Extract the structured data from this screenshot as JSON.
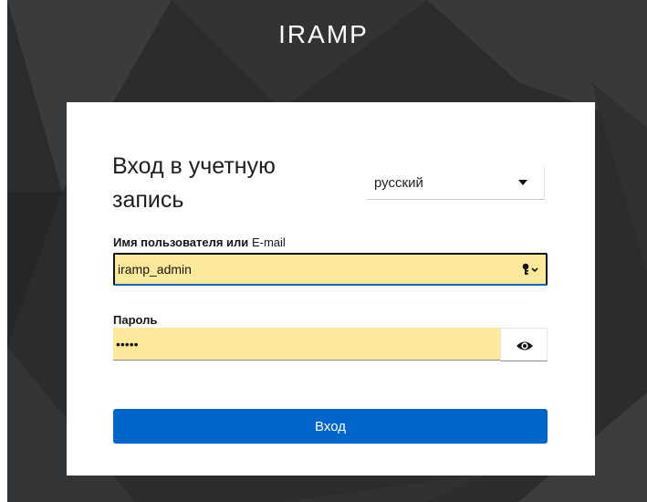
{
  "brand": {
    "title": "IRAMP"
  },
  "login": {
    "heading": "Вход в учетную запись",
    "language": {
      "selected": "русский",
      "icon": "caret-down-icon"
    },
    "username": {
      "label_bold": "Имя пользователя или",
      "label_light": "E-mail",
      "value": "iramp_admin",
      "icon": "key-icon"
    },
    "password": {
      "label": "Пароль",
      "value": "•••••",
      "toggle_icon": "eye-icon"
    },
    "submit_label": "Вход"
  },
  "colors": {
    "backdrop": "#2b2c2e",
    "autofill": "#fde99a",
    "primary": "#0066cc"
  }
}
